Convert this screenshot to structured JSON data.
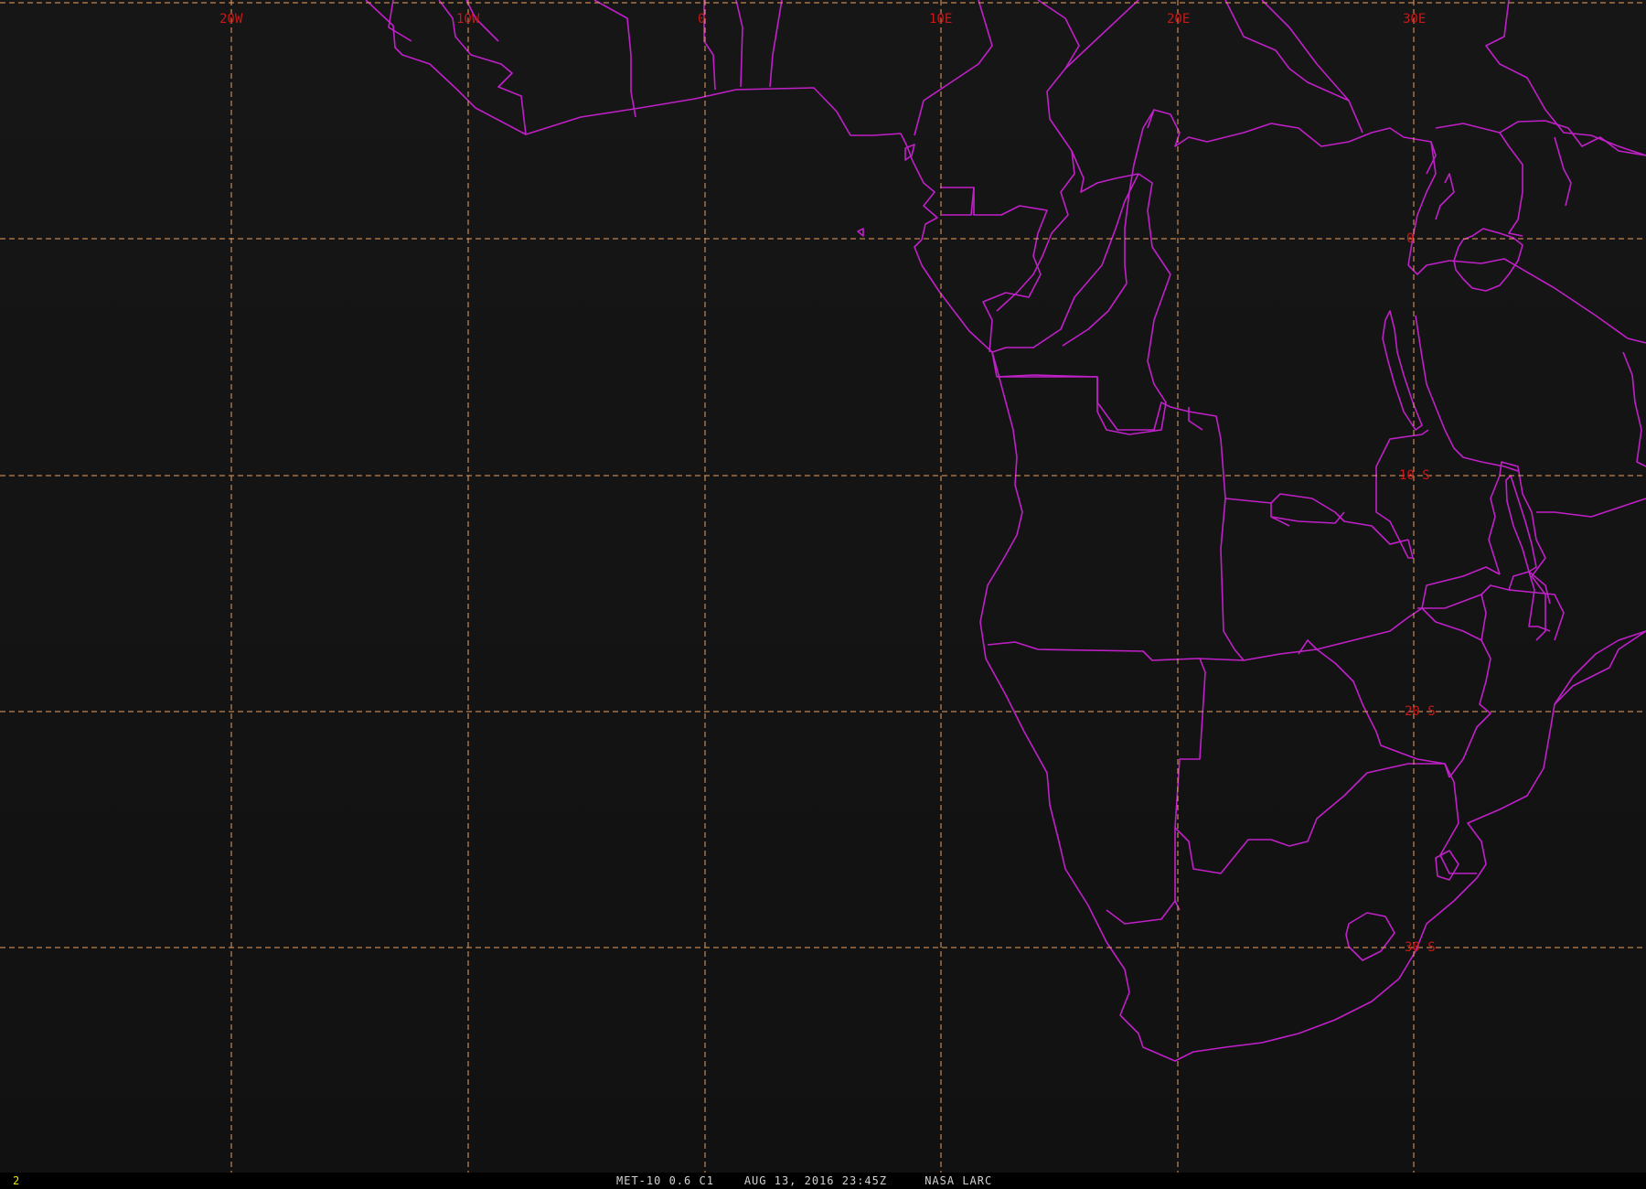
{
  "map": {
    "background": "#141414",
    "grid_color": "#e8a060",
    "coastline_color": "#c020c8",
    "label_color": "#c81818",
    "lon_labels": [
      "20W",
      "10W",
      "0",
      "10E",
      "20E",
      "30E"
    ],
    "lat_labels": [
      "0",
      "10 S",
      "20 S",
      "30 S"
    ]
  },
  "status": {
    "frame": "2",
    "caption": "MET-10 0.6 C1    AUG 13, 2016 23:45Z     NASA LARC"
  }
}
